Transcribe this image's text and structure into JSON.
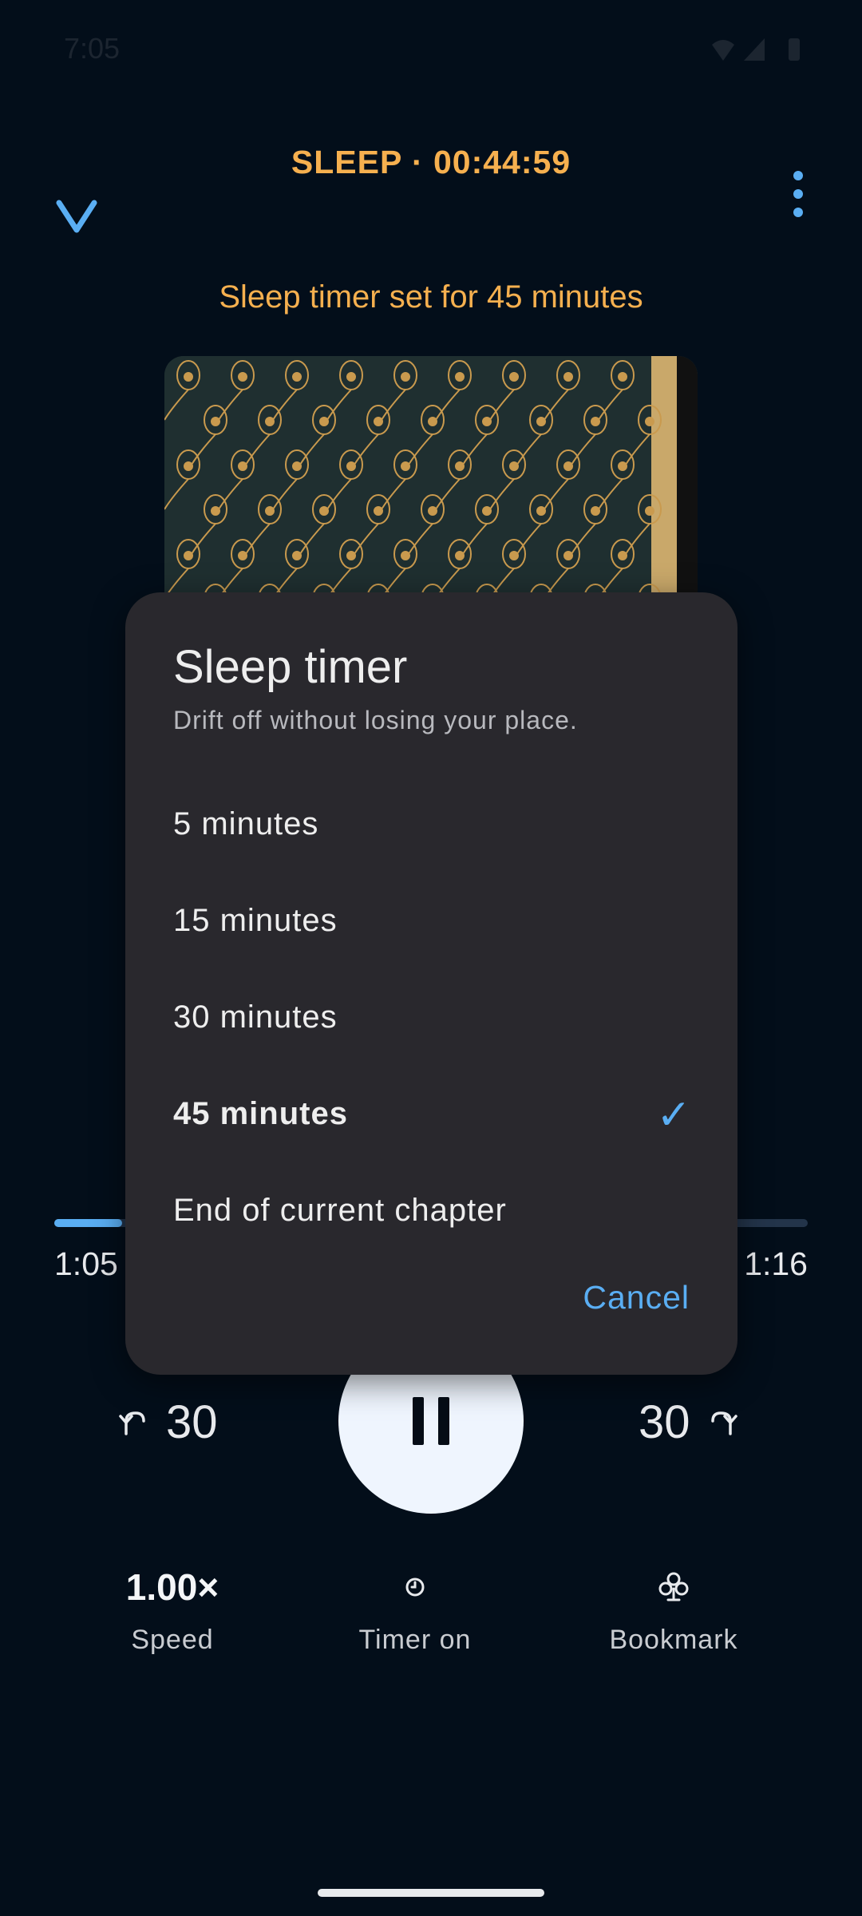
{
  "status_bar": {
    "time": "7:05"
  },
  "header": {
    "title": "SLEEP · 00:44:59",
    "collapse_icon": "chevron-down-icon",
    "more_icon": "more-vert-icon"
  },
  "toast": {
    "text": "Sleep timer set for 45 minutes"
  },
  "player": {
    "progress_fraction": 0.09,
    "elapsed": "1:05",
    "remaining": "1:16",
    "rewind_seconds": "30",
    "forward_seconds": "30"
  },
  "actions": {
    "speed_value": "1.00×",
    "speed_label": "Speed",
    "timer_label": "Timer on",
    "bookmark_label": "Bookmark"
  },
  "dialog": {
    "title": "Sleep timer",
    "subtitle": "Drift off without losing your place.",
    "options": [
      {
        "label": "5 minutes",
        "selected": false
      },
      {
        "label": "15 minutes",
        "selected": false
      },
      {
        "label": "30 minutes",
        "selected": false
      },
      {
        "label": "45 minutes",
        "selected": true
      },
      {
        "label": "End of current chapter",
        "selected": false
      }
    ],
    "check_glyph": "✓",
    "cancel_label": "Cancel"
  },
  "colors": {
    "accent": "#5aaef3",
    "warning": "#f6b04f",
    "background": "#030e1a",
    "dialog": "#29282d"
  }
}
